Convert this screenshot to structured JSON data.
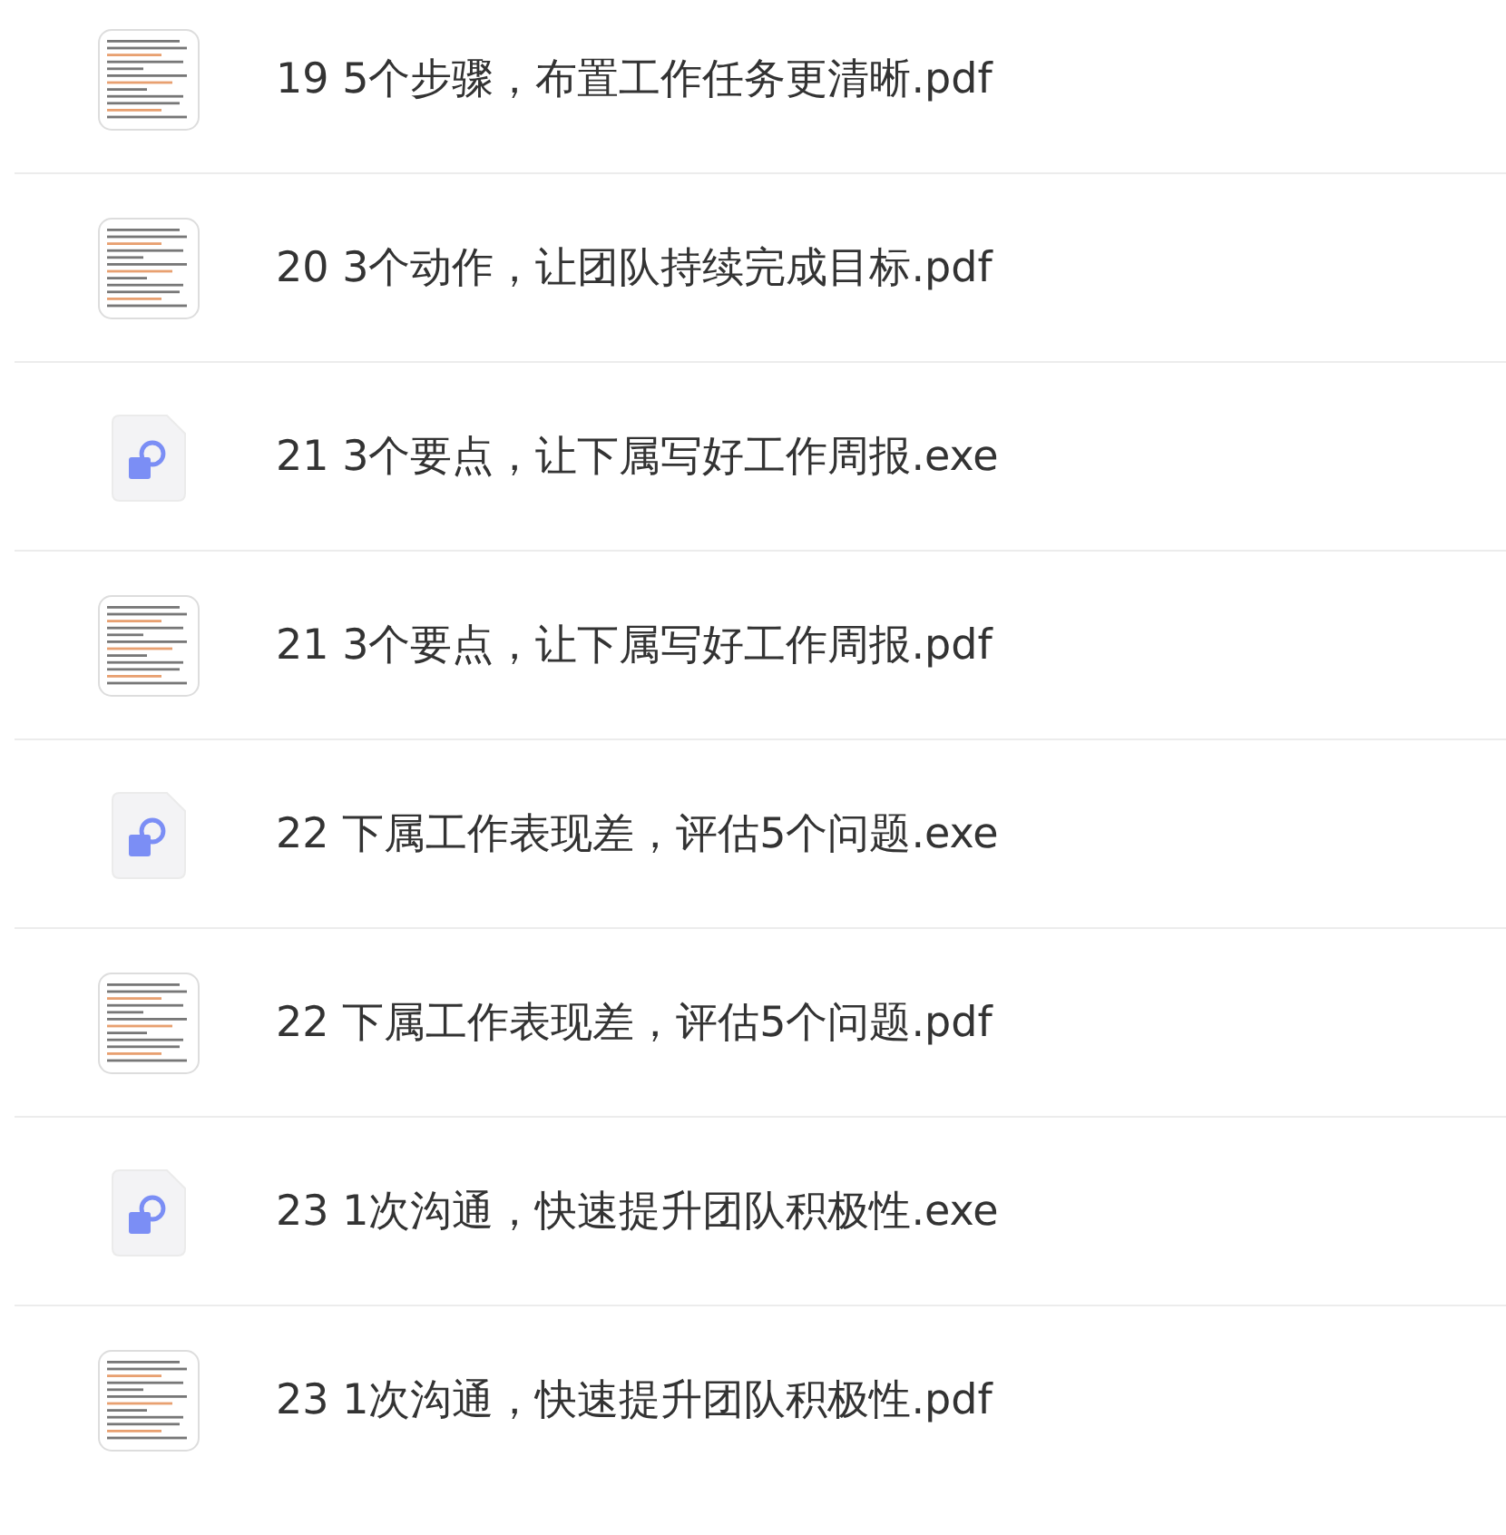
{
  "files": [
    {
      "name": "19 5个步骤，布置工作任务更清晰.pdf",
      "kind": "pdf"
    },
    {
      "name": "20 3个动作，让团队持续完成目标.pdf",
      "kind": "pdf"
    },
    {
      "name": "21 3个要点，让下属写好工作周报.exe",
      "kind": "exe"
    },
    {
      "name": "21 3个要点，让下属写好工作周报.pdf",
      "kind": "pdf"
    },
    {
      "name": "22 下属工作表现差，评估5个问题.exe",
      "kind": "exe"
    },
    {
      "name": "22 下属工作表现差，评估5个问题.pdf",
      "kind": "pdf"
    },
    {
      "name": "23 1次沟通，快速提升团队积极性.exe",
      "kind": "exe"
    },
    {
      "name": "23 1次沟通，快速提升团队积极性.pdf",
      "kind": "pdf"
    }
  ]
}
